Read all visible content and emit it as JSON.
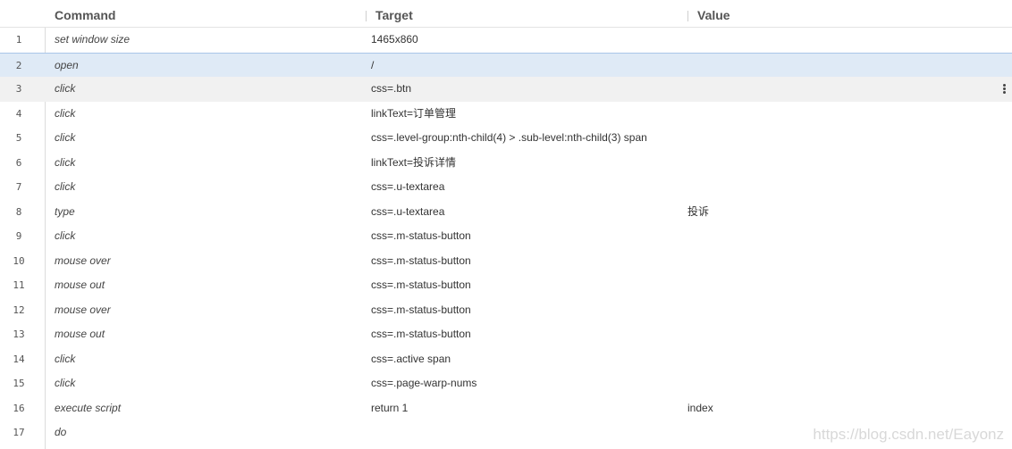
{
  "header": {
    "command": "Command",
    "target": "Target",
    "value": "Value"
  },
  "rows": [
    {
      "num": "1",
      "command": "set window size",
      "target": "1465x860",
      "value": ""
    },
    {
      "num": "2",
      "command": "open",
      "target": "/",
      "value": ""
    },
    {
      "num": "3",
      "command": "click",
      "target": "css=.btn",
      "value": ""
    },
    {
      "num": "4",
      "command": "click",
      "target": "linkText=订单管理",
      "value": ""
    },
    {
      "num": "5",
      "command": "click",
      "target": "css=.level-group:nth-child(4) > .sub-level:nth-child(3) span",
      "value": ""
    },
    {
      "num": "6",
      "command": "click",
      "target": "linkText=投诉详情",
      "value": ""
    },
    {
      "num": "7",
      "command": "click",
      "target": "css=.u-textarea",
      "value": ""
    },
    {
      "num": "8",
      "command": "type",
      "target": "css=.u-textarea",
      "value": "投诉"
    },
    {
      "num": "9",
      "command": "click",
      "target": "css=.m-status-button",
      "value": ""
    },
    {
      "num": "10",
      "command": "mouse over",
      "target": "css=.m-status-button",
      "value": ""
    },
    {
      "num": "11",
      "command": "mouse out",
      "target": "css=.m-status-button",
      "value": ""
    },
    {
      "num": "12",
      "command": "mouse over",
      "target": "css=.m-status-button",
      "value": ""
    },
    {
      "num": "13",
      "command": "mouse out",
      "target": "css=.m-status-button",
      "value": ""
    },
    {
      "num": "14",
      "command": "click",
      "target": "css=.active span",
      "value": ""
    },
    {
      "num": "15",
      "command": "click",
      "target": "css=.page-warp-nums",
      "value": ""
    },
    {
      "num": "16",
      "command": "execute script",
      "target": "return 1",
      "value": "index"
    },
    {
      "num": "17",
      "command": "do",
      "target": "",
      "value": ""
    }
  ],
  "selected_row": 2,
  "hover_row": 3,
  "row_menu_icon": "more-vertical-icon",
  "watermark": "https://blog.csdn.net/Eayonz",
  "colors": {
    "selected_bg": "#dfeaf6",
    "hover_bg": "#f1f1f1",
    "header_text": "#555555"
  }
}
